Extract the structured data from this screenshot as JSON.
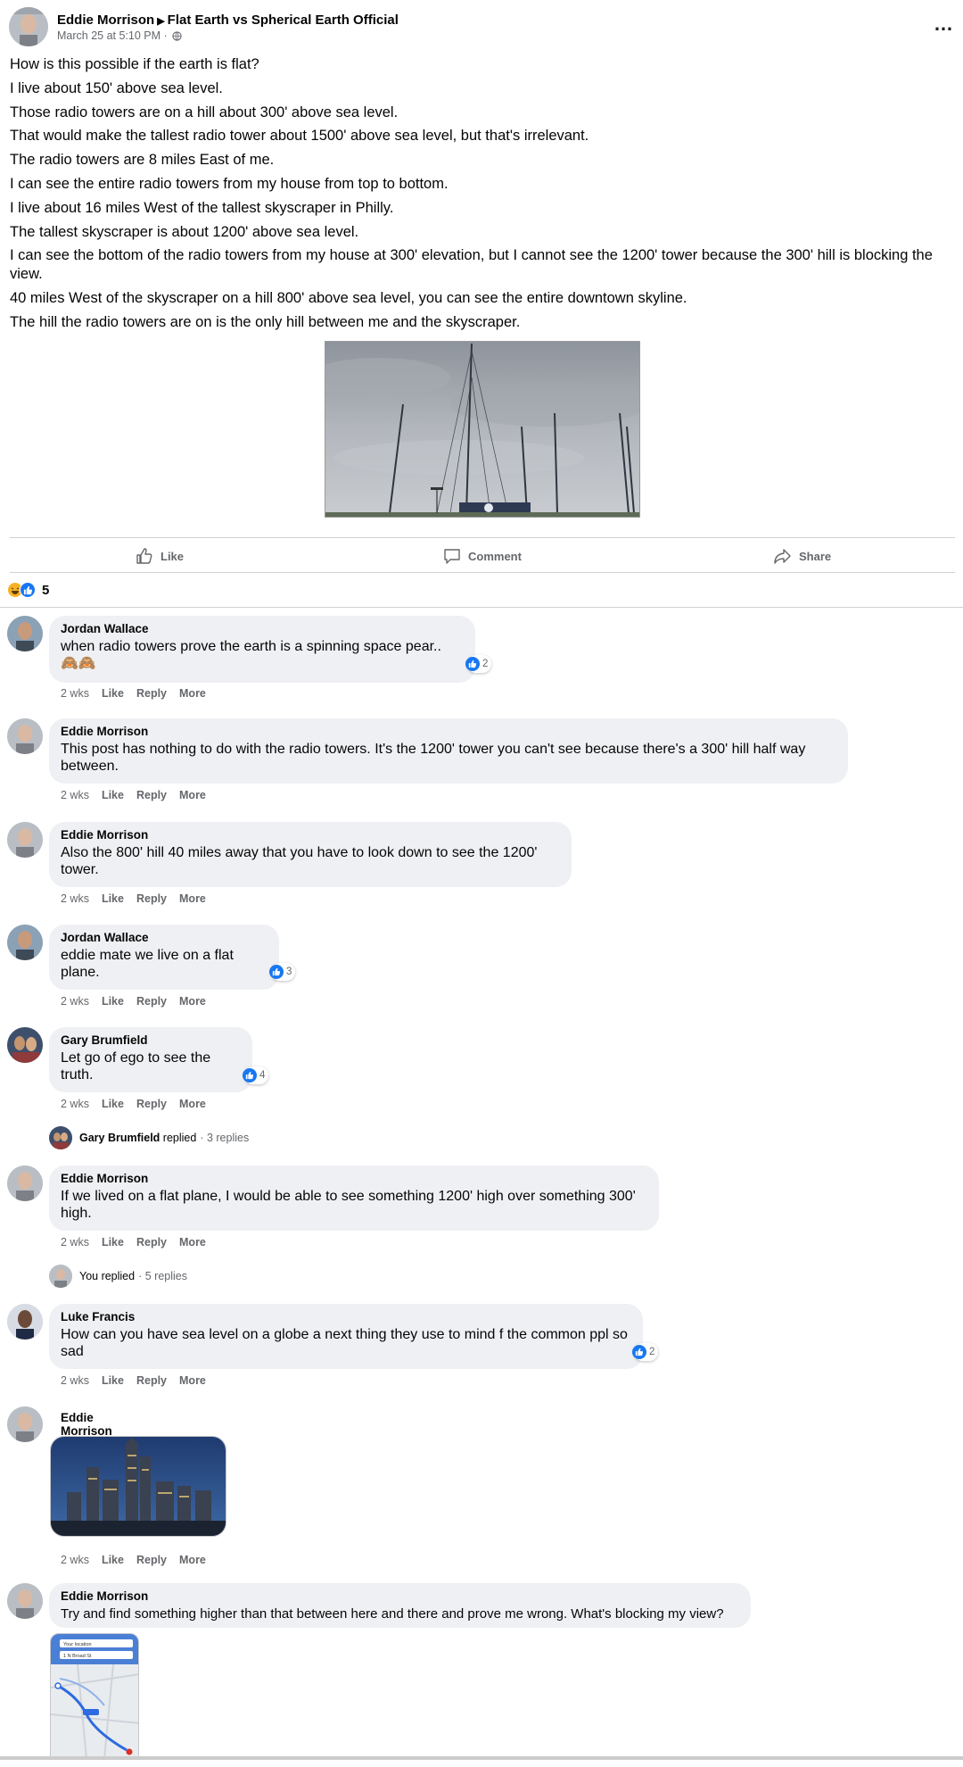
{
  "post": {
    "author": "Eddie Morrison",
    "group": "Flat Earth vs Spherical Earth Official",
    "timestamp": "March 25 at 5:10 PM",
    "more_icon": "…",
    "paragraphs": [
      "How is this possible if the earth is flat?",
      "I live about 150' above sea level.",
      "Those radio towers are on a hill about 300' above sea level.",
      "That would make the tallest radio tower about 1500' above sea level, but that's irrelevant.",
      "The radio towers are 8 miles East of me.",
      "I can see the entire radio towers from my house from top to bottom.",
      "I live about 16 miles West of the tallest skyscraper in Philly.",
      "The tallest skyscraper is about 1200' above sea level.",
      "I can see the bottom of the radio towers from my house at 300' elevation, but I cannot see the 1200' tower because the 300' hill is blocking the view.",
      "40 miles West of the skyscraper on a hill 800' above sea level, you can see the entire downtown skyline.",
      "The hill the radio towers are on is the only hill between me and the skyscraper."
    ]
  },
  "actions": {
    "like": "Like",
    "comment": "Comment",
    "share": "Share"
  },
  "reactions": {
    "count": "5"
  },
  "meta_labels": {
    "time": "2 wks",
    "like": "Like",
    "reply": "Reply",
    "more": "More"
  },
  "comments": [
    {
      "name": "Jordan Wallace",
      "text": "when radio towers prove the earth is a spinning space pear..",
      "text2": "🙈🙈",
      "reactions": "2"
    },
    {
      "name": "Eddie Morrison",
      "text": "This post has nothing to do with the radio towers. It's the 1200' tower you can't see because there's a 300' hill half way between."
    },
    {
      "name": "Eddie Morrison",
      "text": "Also the 800' hill 40 miles away that you have to look down to see the 1200' tower."
    },
    {
      "name": "Jordan Wallace",
      "text": "eddie mate we live on a flat plane.",
      "reactions": "3"
    },
    {
      "name": "Gary Brumfield",
      "text": "Let go of ego to see the truth.",
      "reactions": "4"
    },
    {
      "name": "Eddie Morrison",
      "text": "If we lived on a flat plane, I would be able to see something 1200' high over something 300' high."
    },
    {
      "name": "Luke Francis",
      "text": "How can you have sea level on a globe a next thing they use to mind f the common ppl so sad",
      "reactions": "2"
    },
    {
      "name": "Eddie Morrison"
    },
    {
      "name": "Eddie Morrison",
      "text": "Try and find something higher than that between here and there and prove me wrong. What's blocking my view?"
    }
  ],
  "reply_rows": [
    {
      "name": "Gary Brumfield",
      "verb": "replied",
      "count": "· 3 replies"
    },
    {
      "name": "",
      "verb": "You replied",
      "count": "· 5 replies"
    }
  ],
  "map_texts": {
    "search": "Your location",
    "dest": "1 N Broad St"
  },
  "colors": {
    "like_blue": "#1877f2",
    "haha_yellow": "#f7b125",
    "bubble": "#eef0f3",
    "muted": "#65676b"
  }
}
